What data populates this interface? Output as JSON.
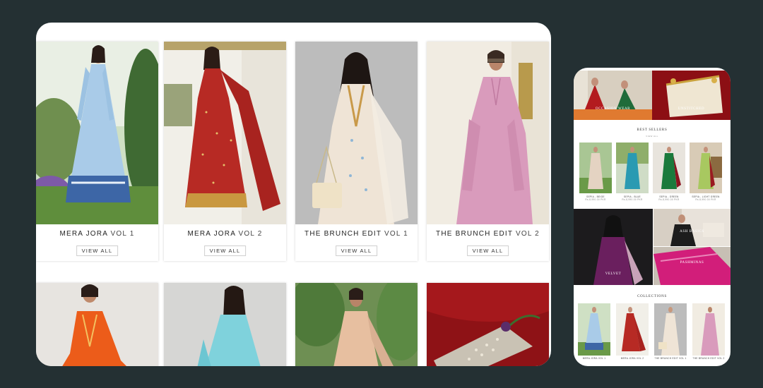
{
  "desktop": {
    "collections": [
      {
        "name": "MERA JORA",
        "vol": "VOL 1",
        "button": "VIEW ALL"
      },
      {
        "name": "MERA JORA",
        "vol": "VOL 2",
        "button": "VIEW ALL"
      },
      {
        "name": "THE BRUNCH EDIT",
        "vol": "VOL 1",
        "button": "VIEW ALL"
      },
      {
        "name": "THE BRUNCH EDIT",
        "vol": "VOL 2",
        "button": "VIEW ALL"
      }
    ]
  },
  "mobile": {
    "hero": {
      "left_label": "OCCASION WEAR",
      "right_label": "UNSTITCHED"
    },
    "best_sellers": {
      "heading": "BEST SELLERS",
      "subheading": "VIEW ALL",
      "items": [
        {
          "name": "SEPIA - BEIGE",
          "price": "Rs.8,990.00 PKR"
        },
        {
          "name": "SEPIA - BLUE",
          "price": "Rs.8,990.00 PKR"
        },
        {
          "name": "SEPIA - GREEN",
          "price": "Rs.8,990.00 PKR"
        },
        {
          "name": "SEPIA - LIGHT GREEN",
          "price": "Rs.8,990.00 PKR"
        }
      ]
    },
    "promo": {
      "velvet": "VELVET",
      "ash_basics": "ASH BASICS",
      "pashminas": "PASHMINAS"
    },
    "collections": {
      "heading": "COLLECTIONS",
      "items": [
        "MERA JORA VOL 1",
        "MERA JORA VOL 2",
        "THE BRUNCH EDIT VOL 1",
        "THE BRUNCH EDIT VOL 2"
      ]
    }
  }
}
